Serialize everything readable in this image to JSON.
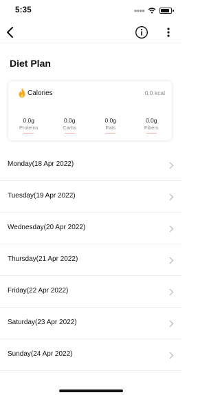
{
  "status_bar": {
    "time": "5:35"
  },
  "page": {
    "title": "Diet Plan"
  },
  "calories": {
    "label": "Calories",
    "value": "0.0 kcal",
    "macros": [
      {
        "value": "0.0g",
        "name": "Proteins"
      },
      {
        "value": "0.0g",
        "name": "Carbs"
      },
      {
        "value": "0.0g",
        "name": "Fats"
      },
      {
        "value": "0.0g",
        "name": "Fibers"
      }
    ]
  },
  "days": [
    {
      "label": "Monday(18 Apr 2022)"
    },
    {
      "label": "Tuesday(19 Apr 2022)"
    },
    {
      "label": "Wednesday(20 Apr 2022)"
    },
    {
      "label": "Thursday(21 Apr 2022)"
    },
    {
      "label": "Friday(22 Apr 2022)"
    },
    {
      "label": "Saturday(23 Apr 2022)"
    },
    {
      "label": "Sunday(24 Apr 2022)"
    }
  ],
  "icons": {
    "back": "chevron-left-icon",
    "info": "info-icon",
    "more": "more-vertical-icon",
    "calories": "flame-icon",
    "row": "chevron-right-icon"
  },
  "colors": {
    "flame": "#f5a623",
    "macro_underline": "#f0a8a0"
  }
}
